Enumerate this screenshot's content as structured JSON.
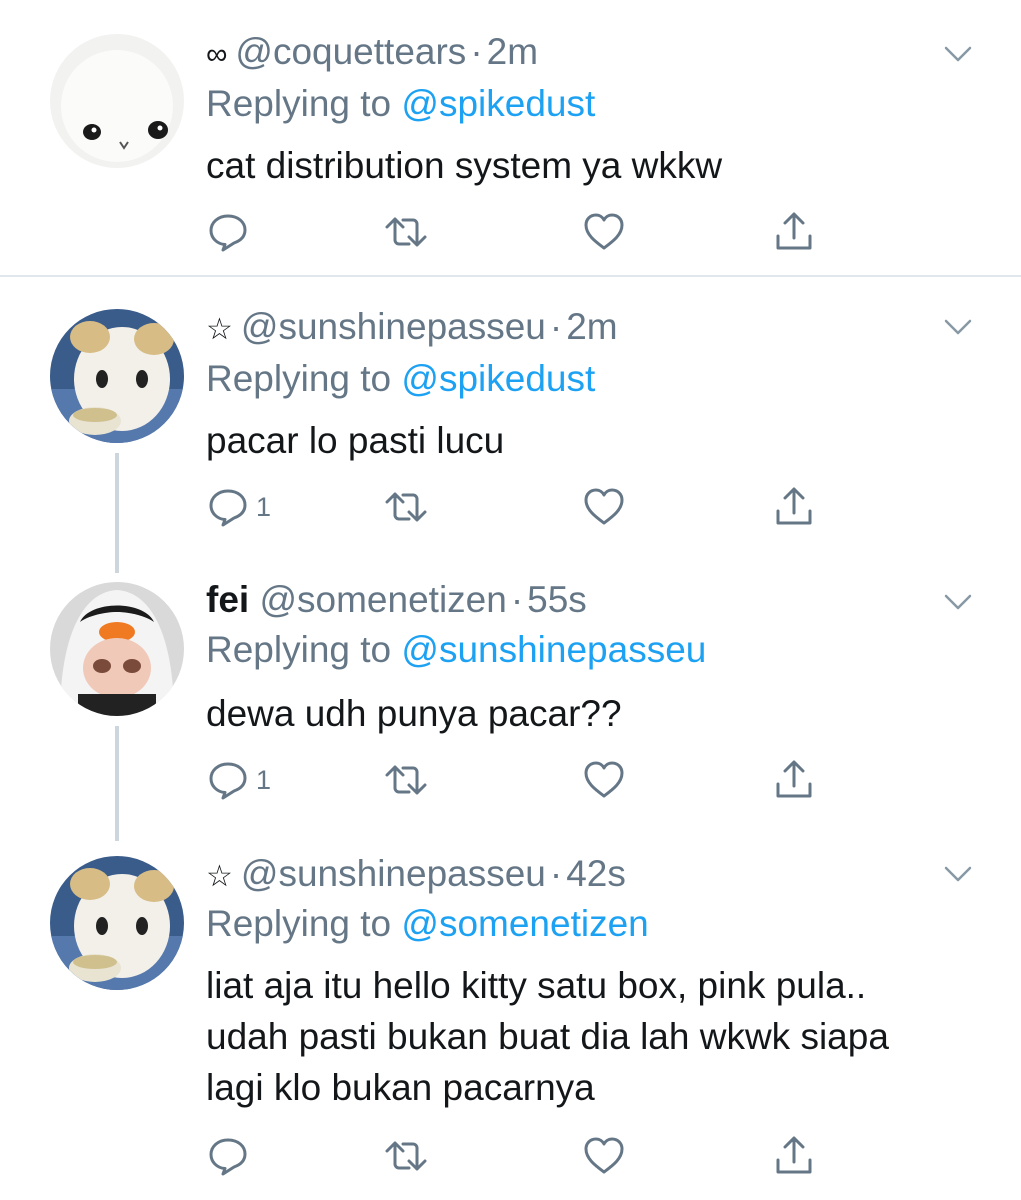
{
  "tweets": [
    {
      "prefix_icon": "infinity",
      "prefix": "∞",
      "display_name": "",
      "handle": "@coquettears",
      "time": "2m",
      "replying_label": "Replying to",
      "replying_to": "@spikedust",
      "text_lines": [
        "cat distribution system ya wkkw"
      ],
      "reply_count": "",
      "avatar": "white-plush-puppy"
    },
    {
      "prefix_icon": "star",
      "prefix": "☆",
      "display_name": "",
      "handle": "@sunshinepasseu",
      "time": "2m",
      "replying_label": "Replying to",
      "replying_to": "@spikedust",
      "text_lines": [
        "pacar lo pasti lucu"
      ],
      "reply_count": "1",
      "avatar": "plush-toy-with-bowl"
    },
    {
      "prefix_icon": "",
      "prefix": "",
      "display_name": "fei",
      "handle": "@somenetizen",
      "time": "55s",
      "replying_label": "Replying to",
      "replying_to": "@sunshinepasseu",
      "text_lines": [
        "dewa udh punya pacar??"
      ],
      "reply_count": "1",
      "avatar": "doll-in-penguin-hat"
    },
    {
      "prefix_icon": "star",
      "prefix": "☆",
      "display_name": "",
      "handle": "@sunshinepasseu",
      "time": "42s",
      "replying_label": "Replying to",
      "replying_to": "@somenetizen",
      "text_lines": [
        "liat aja itu hello kitty satu box, pink pula..",
        "udah pasti bukan buat dia lah wkwk siapa",
        "lagi klo bukan pacarnya"
      ],
      "reply_count": "",
      "avatar": "plush-toy-with-bowl"
    }
  ],
  "colors": {
    "link": "#1da1f2",
    "secondary_text": "#657786",
    "primary_text": "#14171a",
    "divider": "#e1e8ed",
    "thread_line": "#cdd6dd"
  },
  "icons": [
    "reply-icon",
    "retweet-icon",
    "like-icon",
    "share-icon",
    "chevron-down-icon"
  ]
}
